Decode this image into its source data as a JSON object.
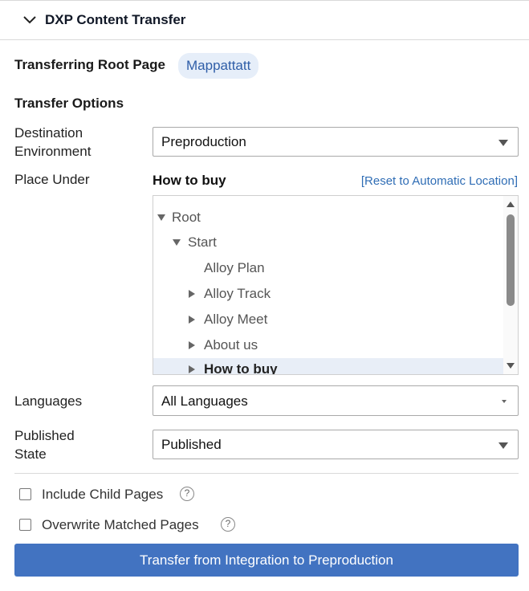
{
  "header": {
    "title": "DXP Content Transfer",
    "collapse_icon": "chevron-down-icon"
  },
  "root_page": {
    "label": "Transferring Root Page",
    "value": "Mappattatt"
  },
  "options_heading": "Transfer Options",
  "destination": {
    "label_line1": "Destination",
    "label_line2": "Environment",
    "value": "Preproduction"
  },
  "place_under": {
    "label": "Place Under",
    "current": "How to buy",
    "reset_link": "[Reset to Automatic Location]",
    "tree": [
      {
        "label": "Root",
        "expander": "expanded",
        "selected": false
      },
      {
        "label": "Start",
        "expander": "expanded",
        "selected": false
      },
      {
        "label": "Alloy Plan",
        "expander": "none",
        "selected": false
      },
      {
        "label": "Alloy Track",
        "expander": "collapsed",
        "selected": false
      },
      {
        "label": "Alloy Meet",
        "expander": "collapsed",
        "selected": false
      },
      {
        "label": "About us",
        "expander": "collapsed",
        "selected": false
      },
      {
        "label": "How to buy",
        "expander": "collapsed",
        "selected": true
      }
    ]
  },
  "languages": {
    "label": "Languages",
    "value": "All Languages"
  },
  "published_state": {
    "label_line1": "Published",
    "label_line2": "State",
    "value": "Published"
  },
  "include_child": {
    "label": "Include Child Pages",
    "checked": false,
    "help": "?"
  },
  "overwrite": {
    "label": "Overwrite Matched Pages",
    "checked": false,
    "help": "?"
  },
  "transfer_button": "Transfer from Integration to Preproduction",
  "colors": {
    "primary": "#4273c1",
    "badge_bg": "#e6eef9",
    "badge_text": "#2f5ea8",
    "link": "#2f6db5",
    "selected_row": "#e8eef7"
  }
}
